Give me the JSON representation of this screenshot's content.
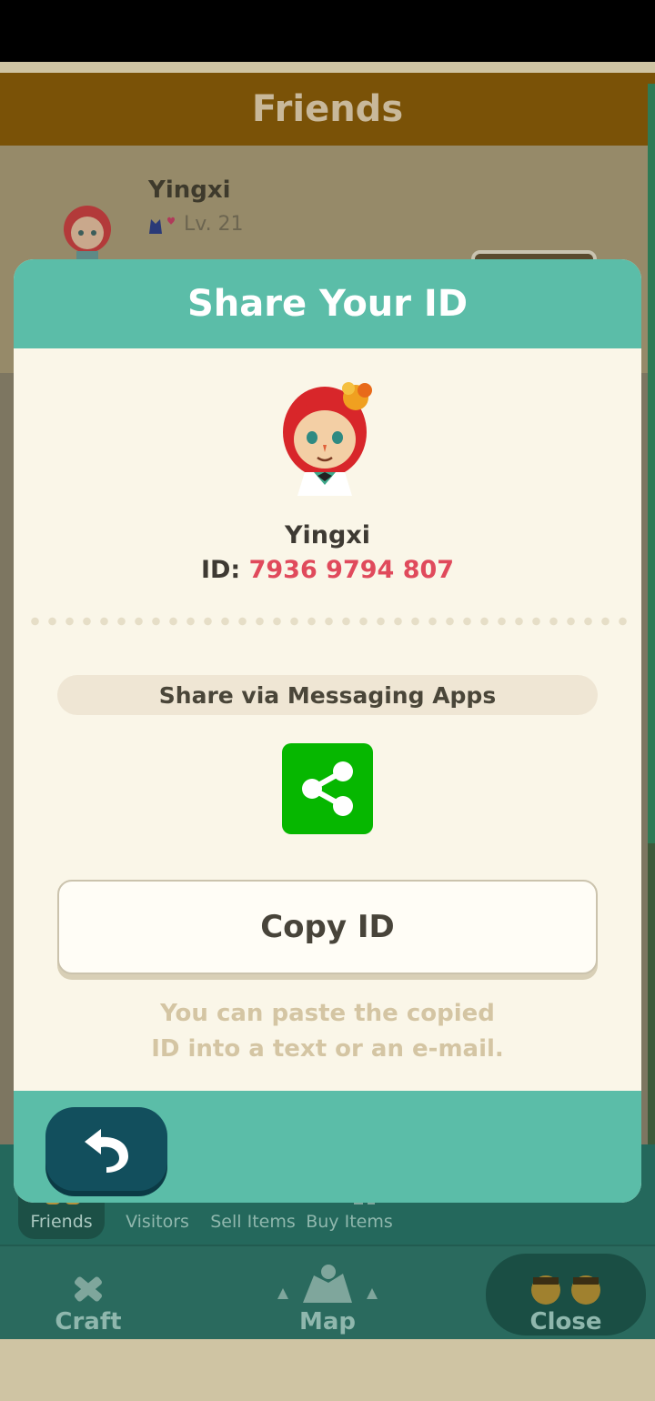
{
  "background": {
    "header_title": "Friends",
    "friend": {
      "name": "Yingxi",
      "level": "Lv. 21"
    },
    "tabs": [
      {
        "label": "Friends",
        "active": true
      },
      {
        "label": "Visitors",
        "active": false
      },
      {
        "label": "Sell Items",
        "active": false
      },
      {
        "label": "Buy Items",
        "active": false
      }
    ],
    "bottom_nav": {
      "craft": "Craft",
      "map": "Map",
      "close": "Close"
    }
  },
  "dialog": {
    "title": "Share Your ID",
    "user_name": "Yingxi",
    "id_label": "ID:",
    "id_value": "7936 9794 807",
    "share_label": "Share via Messaging Apps",
    "copy_button": "Copy ID",
    "hint_line1": "You can paste the copied",
    "hint_line2": "ID into a text or an e-mail."
  },
  "colors": {
    "accent_teal": "#5bbda8",
    "id_red": "#e04a5c",
    "share_green": "#06b700",
    "back_button": "#124f5d"
  },
  "icons": [
    "avatar",
    "share-icon",
    "back-arrow-icon",
    "friends-icon",
    "visitors-icon",
    "sell-items-icon",
    "buy-items-icon",
    "craft-icon",
    "map-icon",
    "close-icon",
    "cat-icon",
    "heart-icon"
  ]
}
